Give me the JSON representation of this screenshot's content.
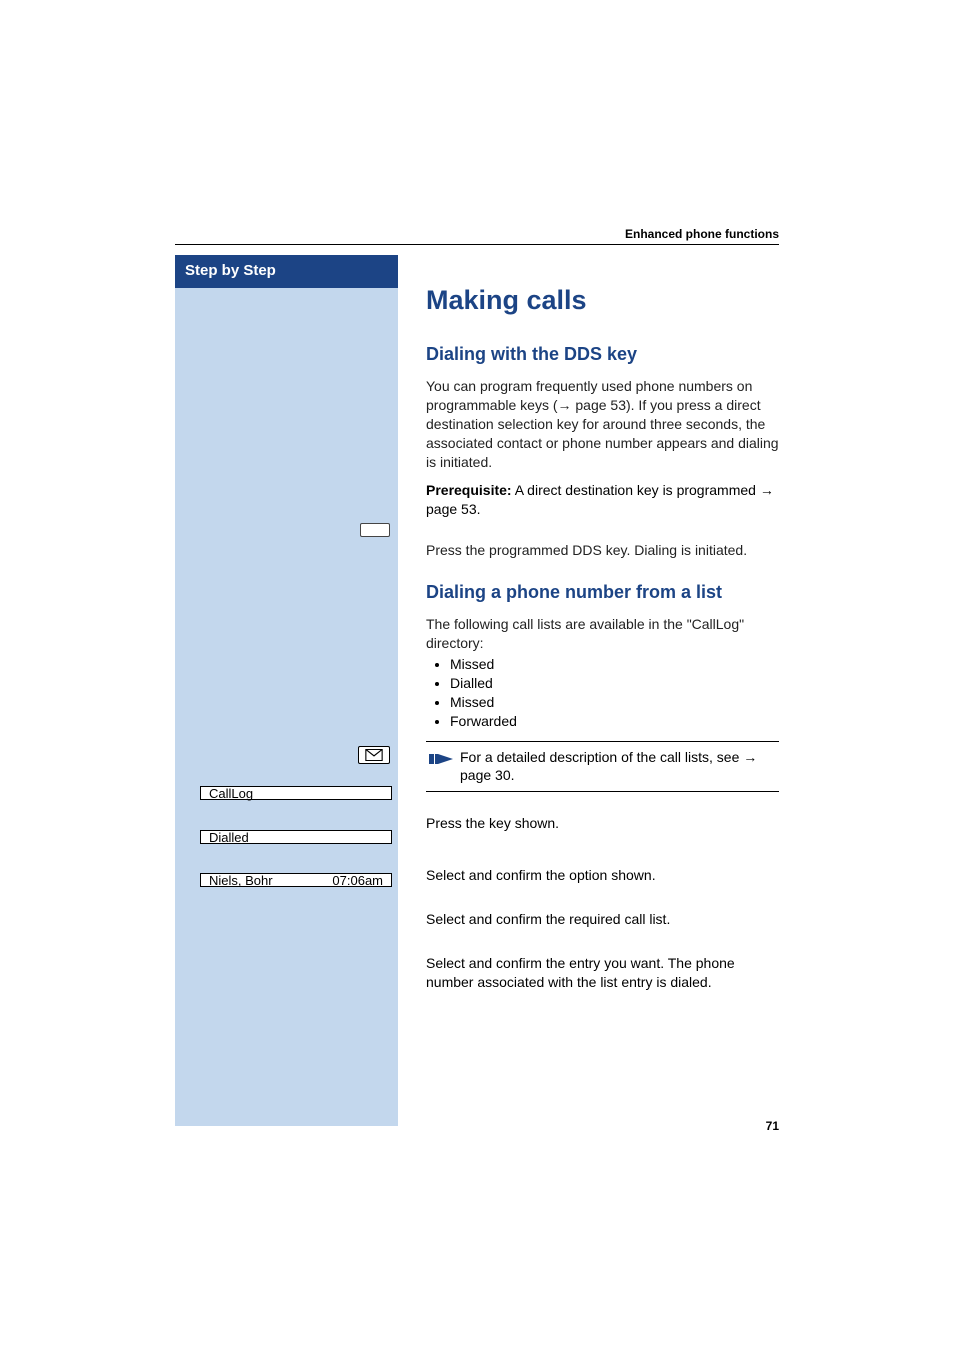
{
  "header": {
    "section_title": "Enhanced phone functions"
  },
  "sidebar": {
    "title": "Step by Step",
    "display_boxes": {
      "calllog": {
        "label": "CallLog"
      },
      "dialled": {
        "label": "Dialled"
      },
      "entry": {
        "name": "Niels, Bohr",
        "time": "07:06am"
      }
    }
  },
  "content": {
    "h1": "Making calls",
    "dds": {
      "heading": "Dialing with the DDS key",
      "para": "You can program frequently used phone numbers on programmable keys (→ page 53). If you press a direct destination selection key for around three seconds, the associated contact or phone number appears and dialing is initiated.",
      "prereq_label": "Prerequisite:",
      "prereq_text": " A direct destination key is programmed → page 53.",
      "press_text": "Press the programmed DDS key. Dialing is initiated."
    },
    "list": {
      "heading": "Dialing a phone number from a list",
      "intro": "The following call lists are available in the \"CallLog\" directory:",
      "bullets": [
        "Missed",
        "Dialled",
        "Missed",
        "Forwarded"
      ],
      "note": "For a detailed description of the call lists, see → page 30.",
      "press_key": "Press the key shown.",
      "opt_calllog": "Select and confirm the option shown.",
      "opt_dialled": "Select and confirm the required call list.",
      "opt_entry": "Select and confirm the entry you want. The phone number associated with the list entry is dialed."
    }
  },
  "page_number": "71"
}
